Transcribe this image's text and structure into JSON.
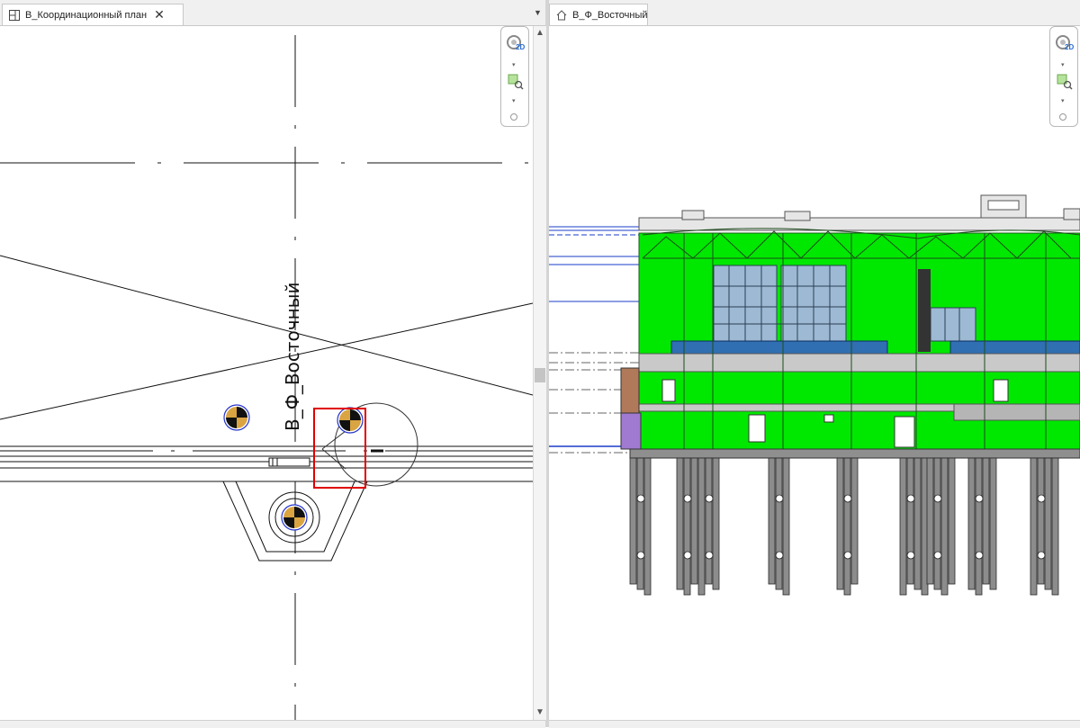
{
  "left_view": {
    "tab_title": "В_Координационный план",
    "tab_icon": "floor-plan-icon",
    "elevation_label": "В_Ф_Восточный"
  },
  "right_view": {
    "tab_title": "В_Ф_Восточный",
    "tab_icon": "elevation-house-icon"
  },
  "navigation_bar": {
    "full_navigation_wheel_badge": "2D",
    "icons": [
      "navigation-wheel-icon",
      "zoom-region-icon"
    ]
  },
  "window_controls": {
    "tab_menu_icon": "dropdown-arrow-icon",
    "scroll_up_icon": "scroll-up-arrow-icon",
    "scroll_down_icon": "scroll-down-arrow-icon"
  },
  "colors": {
    "building_fill": "#00e800",
    "window_glass": "#9db9d3",
    "railing": "#2f6fb2",
    "piles": "#8c8c8c",
    "selection_box": "#e00000",
    "level_lines": "#1a3cc8"
  }
}
